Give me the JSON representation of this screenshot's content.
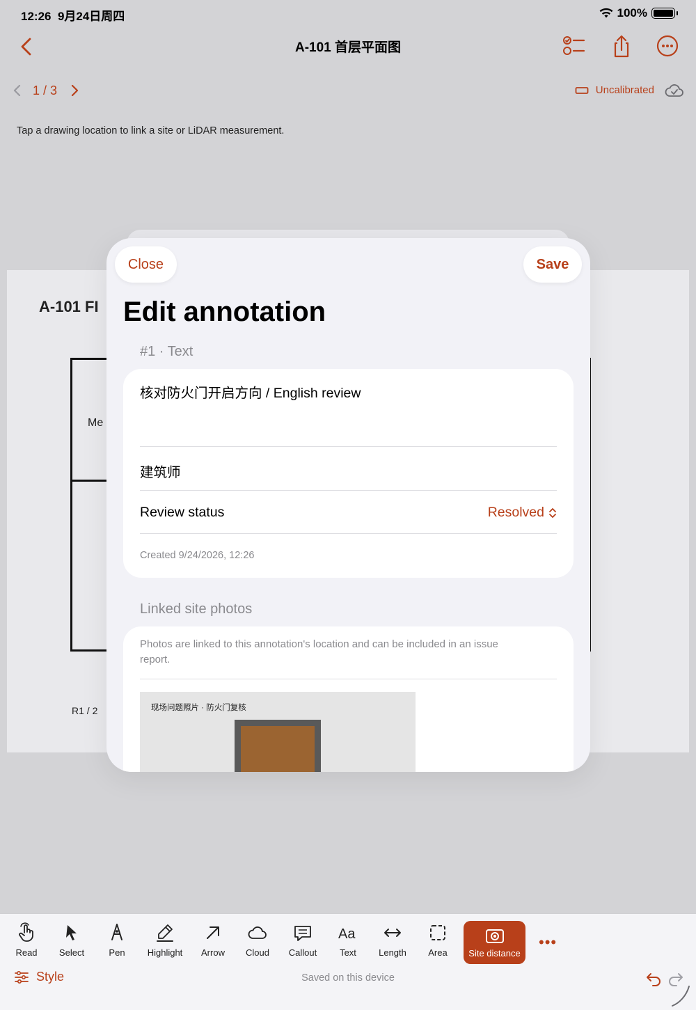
{
  "status_bar": {
    "time": "12:26",
    "date": "9月24日周四",
    "battery": "100%"
  },
  "header": {
    "title": "A-101 首层平面图",
    "icons": [
      "back-chevron-icon",
      "checklist-icon",
      "share-icon",
      "more-ellipsis-icon"
    ]
  },
  "pager": {
    "page": "1 / 3",
    "calibration": "Uncalibrated"
  },
  "hint": "Tap a drawing location to link a site or LiDAR measurement.",
  "sheet": {
    "title": "A-101 FI",
    "room": "Me",
    "legend": "R1  /  2"
  },
  "modal": {
    "close_label": "Close",
    "save_label": "Save",
    "title": "Edit annotation",
    "annotation_label": "#1 · Text",
    "note_text": "核对防火门开启方向 / English review",
    "author": "建筑师",
    "review_label": "Review status",
    "review_value": "Resolved",
    "created": "Created 9/24/2026, 12:26",
    "photos_section_label": "Linked site photos",
    "photos_description": "Photos are linked to this annotation's location and can be included in an issue report.",
    "photo_caption": "现场问题照片 · 防火门复核"
  },
  "toolbar": {
    "tools": [
      {
        "label": "Read",
        "icon": "hand-pointer-icon"
      },
      {
        "label": "Select",
        "icon": "cursor-arrow-icon"
      },
      {
        "label": "Pen",
        "icon": "pen-nib-icon"
      },
      {
        "label": "Highlight",
        "icon": "highlighter-icon"
      },
      {
        "label": "Arrow",
        "icon": "arrow-icon"
      },
      {
        "label": "Cloud",
        "icon": "cloud-icon"
      },
      {
        "label": "Callout",
        "icon": "callout-bubble-icon"
      },
      {
        "label": "Text",
        "icon": "text-aa-icon"
      },
      {
        "label": "Length",
        "icon": "length-arrows-icon"
      },
      {
        "label": "Area",
        "icon": "area-dashed-icon"
      },
      {
        "label": "Site distance",
        "icon": "camera-target-icon",
        "active": true
      }
    ],
    "style_label": "Style",
    "saved_status": "Saved on this device",
    "accent_color": "#b8401a"
  }
}
